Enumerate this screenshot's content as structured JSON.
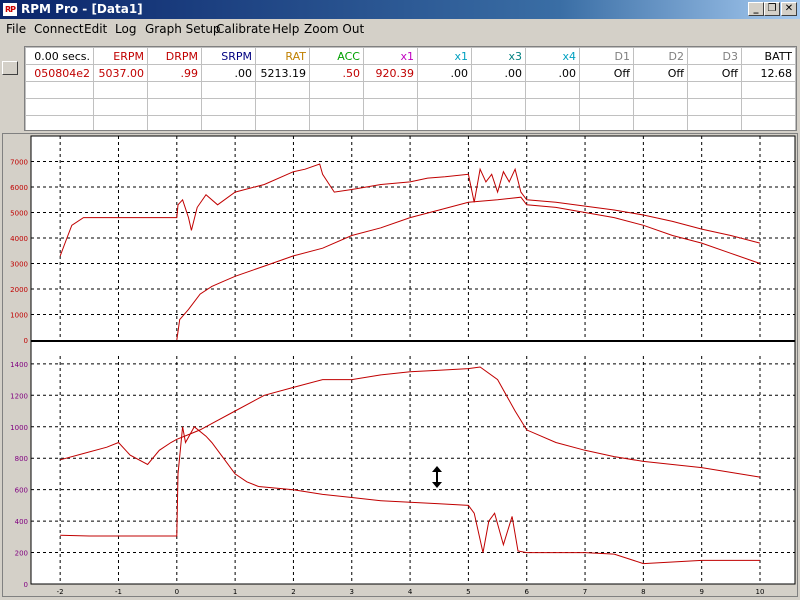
{
  "window": {
    "title": "RPM Pro - [Data1]",
    "app_icon_text": "RP"
  },
  "menu": [
    "File",
    "Connect",
    "Edit",
    "Log",
    "Graph Setup",
    "Calibrate",
    "Help",
    "Zoom Out"
  ],
  "grid": {
    "headers": [
      "0.00 secs.",
      "ERPM",
      "DRPM",
      "SRPM",
      "RAT",
      "ACC",
      "x1",
      "x1",
      "x3",
      "x4",
      "D1",
      "D2",
      "D3",
      "BATT"
    ],
    "header_colors": [
      "#000000",
      "#c00000",
      "#c00000",
      "#000080",
      "#c08000",
      "#00a000",
      "#c000c0",
      "#00a0c0",
      "#008080",
      "#00a0c0",
      "#808080",
      "#808080",
      "#808080",
      "#000000"
    ],
    "values": [
      "050804e2",
      "5037.00",
      ".99",
      ".00",
      "5213.19",
      ".50",
      "920.39",
      ".00",
      ".00",
      ".00",
      "Off",
      "Off",
      "Off",
      "12.68"
    ],
    "value_colors": [
      "#c00000",
      "#c00000",
      "#c00000",
      "#000000",
      "#000000",
      "#c00000",
      "#c00000",
      "#000000",
      "#000000",
      "#000000",
      "#000000",
      "#000000",
      "#000000",
      "#000000"
    ]
  },
  "chart_data": [
    {
      "type": "line",
      "x_ticks": [
        -2,
        -1,
        0,
        1,
        2,
        3,
        4,
        5,
        6,
        7,
        8,
        9,
        10
      ],
      "xlim": [
        -2.5,
        10.6
      ],
      "ylim": [
        0,
        8000
      ],
      "y_ticks": [
        0,
        1000,
        2000,
        3000,
        4000,
        5000,
        6000,
        7000
      ],
      "grid": true,
      "tick_label_color": "#c00000",
      "series": [
        {
          "color": "#c00000",
          "x": [
            -2,
            -1.9,
            -1.8,
            -1.6,
            -1.2,
            -0.5,
            0,
            0.02,
            0.1,
            0.2,
            0.25,
            0.35,
            0.5,
            0.7,
            1,
            1.5,
            2,
            2.2,
            2.45,
            2.5,
            2.7,
            3,
            3.5,
            4,
            4.3,
            4.6,
            5,
            5.1,
            5.2,
            5.3,
            5.4,
            5.5,
            5.6,
            5.7,
            5.8,
            5.9,
            6,
            6.5,
            7,
            7.5,
            8,
            8.5,
            9,
            9.5,
            10
          ],
          "y": [
            3300,
            3900,
            4500,
            4800,
            4800,
            4800,
            4800,
            5300,
            5500,
            4800,
            4300,
            5200,
            5700,
            5300,
            5800,
            6100,
            6600,
            6700,
            6900,
            6500,
            5800,
            5900,
            6100,
            6200,
            6350,
            6400,
            6500,
            5400,
            6700,
            6200,
            6500,
            5800,
            6600,
            6200,
            6700,
            5800,
            5500,
            5400,
            5250,
            5100,
            4900,
            4650,
            4350,
            4100,
            3800
          ]
        },
        {
          "color": "#c00000",
          "x": [
            0,
            0.05,
            0.2,
            0.4,
            0.6,
            0.8,
            1,
            1.5,
            2,
            2.5,
            3,
            3.5,
            4,
            4.5,
            5,
            5.5,
            5.9,
            6,
            6.5,
            7,
            7.5,
            8,
            8.5,
            9,
            9.5,
            10
          ],
          "y": [
            0,
            800,
            1200,
            1800,
            2100,
            2300,
            2500,
            2900,
            3300,
            3600,
            4100,
            4400,
            4800,
            5100,
            5400,
            5500,
            5600,
            5300,
            5200,
            5000,
            4800,
            4500,
            4100,
            3800,
            3400,
            3000
          ]
        }
      ]
    },
    {
      "type": "line",
      "x_ticks": [
        -2,
        -1,
        0,
        1,
        2,
        3,
        4,
        5,
        6,
        7,
        8,
        9,
        10
      ],
      "xlim": [
        -2.5,
        10.6
      ],
      "ylim": [
        0,
        1450
      ],
      "y_ticks": [
        0,
        200,
        400,
        600,
        800,
        1000,
        1200,
        1400
      ],
      "grid": true,
      "tick_label_color": "#800080",
      "series": [
        {
          "color": "#c00000",
          "x": [
            -2,
            -1.6,
            -1.2,
            -1,
            -0.8,
            -0.5,
            -0.3,
            -0.1,
            0,
            0.2,
            0.4,
            0.6,
            1,
            1.5,
            2,
            2.5,
            3,
            3.5,
            4,
            4.5,
            5,
            5.2,
            5.5,
            5.8,
            6,
            6.5,
            7,
            7.5,
            8,
            8.5,
            9,
            9.5,
            10
          ],
          "y": [
            790,
            830,
            870,
            900,
            820,
            760,
            850,
            900,
            920,
            950,
            980,
            1020,
            1100,
            1200,
            1250,
            1300,
            1300,
            1330,
            1350,
            1360,
            1370,
            1380,
            1300,
            1100,
            980,
            900,
            850,
            810,
            780,
            760,
            740,
            710,
            680
          ]
        },
        {
          "color": "#c00000",
          "x": [
            -2,
            -1.5,
            -1,
            -0.5,
            0,
            0.02,
            0.1,
            0.15,
            0.3,
            0.5,
            0.6,
            0.8,
            1,
            1.2,
            1.4,
            2,
            2.5,
            3,
            3.5,
            4,
            4.5,
            5,
            5.1,
            5.25,
            5.35,
            5.45,
            5.6,
            5.75,
            5.85,
            6,
            6.5,
            7,
            7.5,
            8,
            8.5,
            9,
            9.5,
            10
          ],
          "y": [
            310,
            305,
            305,
            305,
            305,
            700,
            1000,
            900,
            1000,
            940,
            900,
            800,
            700,
            650,
            620,
            600,
            570,
            550,
            530,
            520,
            510,
            500,
            450,
            200,
            400,
            450,
            250,
            430,
            210,
            200,
            200,
            200,
            190,
            130,
            140,
            150,
            150,
            150
          ]
        }
      ]
    }
  ]
}
